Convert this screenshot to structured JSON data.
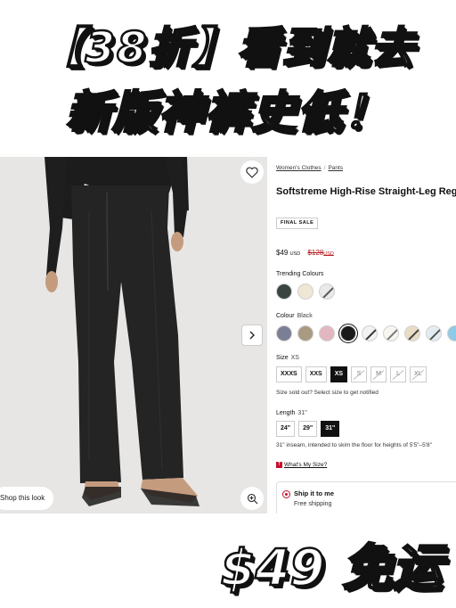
{
  "banner": {
    "line1": "【38折】看到就去",
    "line2": "新版神裤史低！"
  },
  "product": {
    "breadcrumb": [
      "Women's Clothes",
      "Pants"
    ],
    "title": "Softstreme High-Rise Straight-Leg Regular",
    "final_sale": "FINAL SALE",
    "price": "$49",
    "price_currency": "USD",
    "original_price": "$128",
    "original_currency": "USD",
    "shop_look": "Shop this look",
    "trending_label": "Trending Colours",
    "trending_colors": [
      "#3a4541",
      "#efe6d4",
      "stripe-grey"
    ],
    "colour_label": "Colour",
    "colour_value": "Black",
    "colours": [
      "#7a7f95",
      "#a89b82",
      "#e3b7c2",
      "#1a1a1a",
      "stripe-dark",
      "stripe-white",
      "stripe-tan",
      "stripe-blue",
      "#8fcae6"
    ],
    "size_label": "Size",
    "size_value": "XS",
    "sizes": [
      {
        "label": "XXXS",
        "state": "available"
      },
      {
        "label": "XXS",
        "state": "available"
      },
      {
        "label": "XS",
        "state": "selected"
      },
      {
        "label": "S",
        "state": "sold-out"
      },
      {
        "label": "M",
        "state": "sold-out"
      },
      {
        "label": "L",
        "state": "sold-out"
      },
      {
        "label": "XL",
        "state": "sold-out"
      }
    ],
    "sold_out_note": "Size sold out? Select size to get notified",
    "length_label": "Length",
    "length_value": "31\"",
    "lengths": [
      {
        "label": "24\"",
        "state": "available"
      },
      {
        "label": "29\"",
        "state": "available"
      },
      {
        "label": "31\"",
        "state": "selected"
      }
    ],
    "inseam_note": "31\" inseam, intended to skim the floor for heights of 5'5\"–5'8\"",
    "whats_my_size": "What's My Size?",
    "ship_title": "Ship it to me",
    "ship_sub": "Free shipping",
    "accent": "#c8102e"
  },
  "footer": {
    "text": "$49 免运"
  }
}
